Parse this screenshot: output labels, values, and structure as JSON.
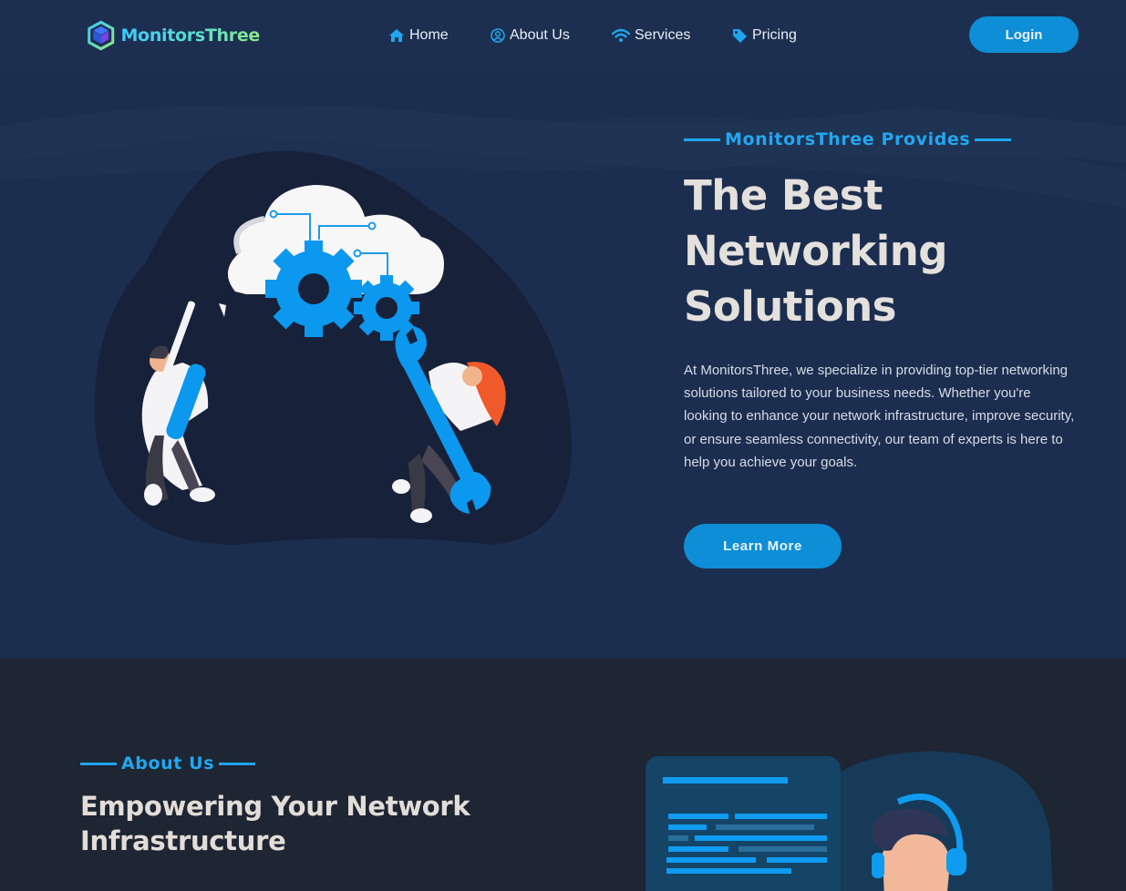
{
  "brand": {
    "name": "MonitorsThree"
  },
  "nav": {
    "items": [
      {
        "label": "Home",
        "icon": "home-icon"
      },
      {
        "label": "About Us",
        "icon": "user-circle-icon"
      },
      {
        "label": "Services",
        "icon": "wifi-icon"
      },
      {
        "label": "Pricing",
        "icon": "tag-icon"
      }
    ],
    "login_label": "Login"
  },
  "hero": {
    "eyebrow": "MonitorsThree Provides",
    "title": "The Best Networking Solutions",
    "text": "At MonitorsThree, we specialize in providing top-tier networking solutions tailored to your business needs. Whether you're looking to enhance your network infrastructure, improve security, or ensure seamless connectivity, our team of experts is here to help you achieve your goals.",
    "cta_label": "Learn More"
  },
  "about": {
    "eyebrow": "About Us",
    "title": "Empowering Your Network Infrastructure"
  },
  "colors": {
    "accent": "#0d8ed6",
    "accent_text": "#22a7f0",
    "hero_bg": "#1c2e4f",
    "about_bg": "#1e2533"
  }
}
